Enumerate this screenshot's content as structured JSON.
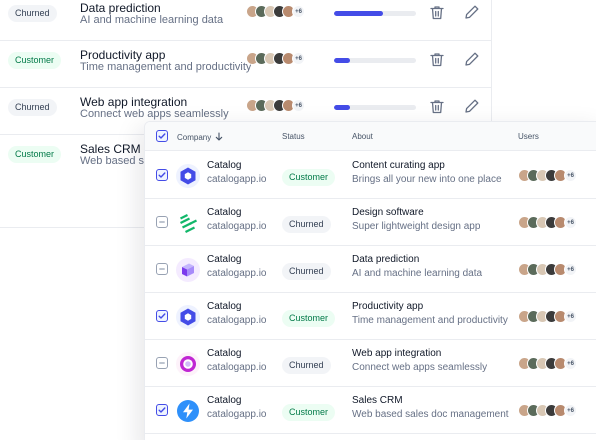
{
  "colors": {
    "accent": "#444ce7",
    "customer_bg": "#ecfdf3",
    "customer_text": "#027a48",
    "churned_bg": "#f2f4f7"
  },
  "avatar_colors": [
    "#c9a58a",
    "#5b6b5b",
    "#d8c7b4",
    "#3b3b3b",
    "#b88a6e",
    "#8c9aa6"
  ],
  "back_table": {
    "rows": [
      {
        "status": "Churned",
        "status_type": "churned",
        "title": "Data prediction",
        "subtitle": "AI and machine learning data",
        "more": "+6",
        "progress": 0.6
      },
      {
        "status": "Customer",
        "status_type": "customer",
        "title": "Productivity app",
        "subtitle": "Time management and productivity",
        "more": "+6",
        "progress": 0.2
      },
      {
        "status": "Churned",
        "status_type": "churned",
        "title": "Web app integration",
        "subtitle": "Connect web apps seamlessly",
        "more": "+6",
        "progress": 0.2
      },
      {
        "status": "Customer",
        "status_type": "customer",
        "title": "Sales CRM",
        "subtitle": "Web based sales doc management",
        "more": "",
        "progress": 0
      }
    ]
  },
  "front_table": {
    "headers": {
      "company": "Company",
      "sort_icon": "arrow-down-icon",
      "status": "Status",
      "about": "About",
      "users": "Users"
    },
    "rows": [
      {
        "checked": true,
        "logo": "hexagon-logo",
        "company": "Catalog",
        "domain": "catalogapp.io",
        "status": "Customer",
        "status_type": "customer",
        "title": "Content curating app",
        "subtitle": "Brings all your new into one place",
        "more": "+6"
      },
      {
        "checked": false,
        "logo": "stripes-logo",
        "company": "Catalog",
        "domain": "catalogapp.io",
        "status": "Churned",
        "status_type": "churned",
        "title": "Design software",
        "subtitle": "Super lightweight design app",
        "more": "+6"
      },
      {
        "checked": false,
        "logo": "cube-logo",
        "company": "Catalog",
        "domain": "catalogapp.io",
        "status": "Churned",
        "status_type": "churned",
        "title": "Data prediction",
        "subtitle": "AI and machine learning data",
        "more": "+6"
      },
      {
        "checked": true,
        "logo": "hexagon-logo",
        "company": "Catalog",
        "domain": "catalogapp.io",
        "status": "Customer",
        "status_type": "customer",
        "title": "Productivity app",
        "subtitle": "Time management and productivity",
        "more": "+6"
      },
      {
        "checked": false,
        "logo": "ring-logo",
        "company": "Catalog",
        "domain": "catalogapp.io",
        "status": "Churned",
        "status_type": "churned",
        "title": "Web app integration",
        "subtitle": "Connect web apps seamlessly",
        "more": "+6"
      },
      {
        "checked": true,
        "logo": "bolt-logo",
        "company": "Catalog",
        "domain": "catalogapp.io",
        "status": "Customer",
        "status_type": "customer",
        "title": "Sales CRM",
        "subtitle": "Web based sales doc management",
        "more": "+6"
      }
    ]
  }
}
